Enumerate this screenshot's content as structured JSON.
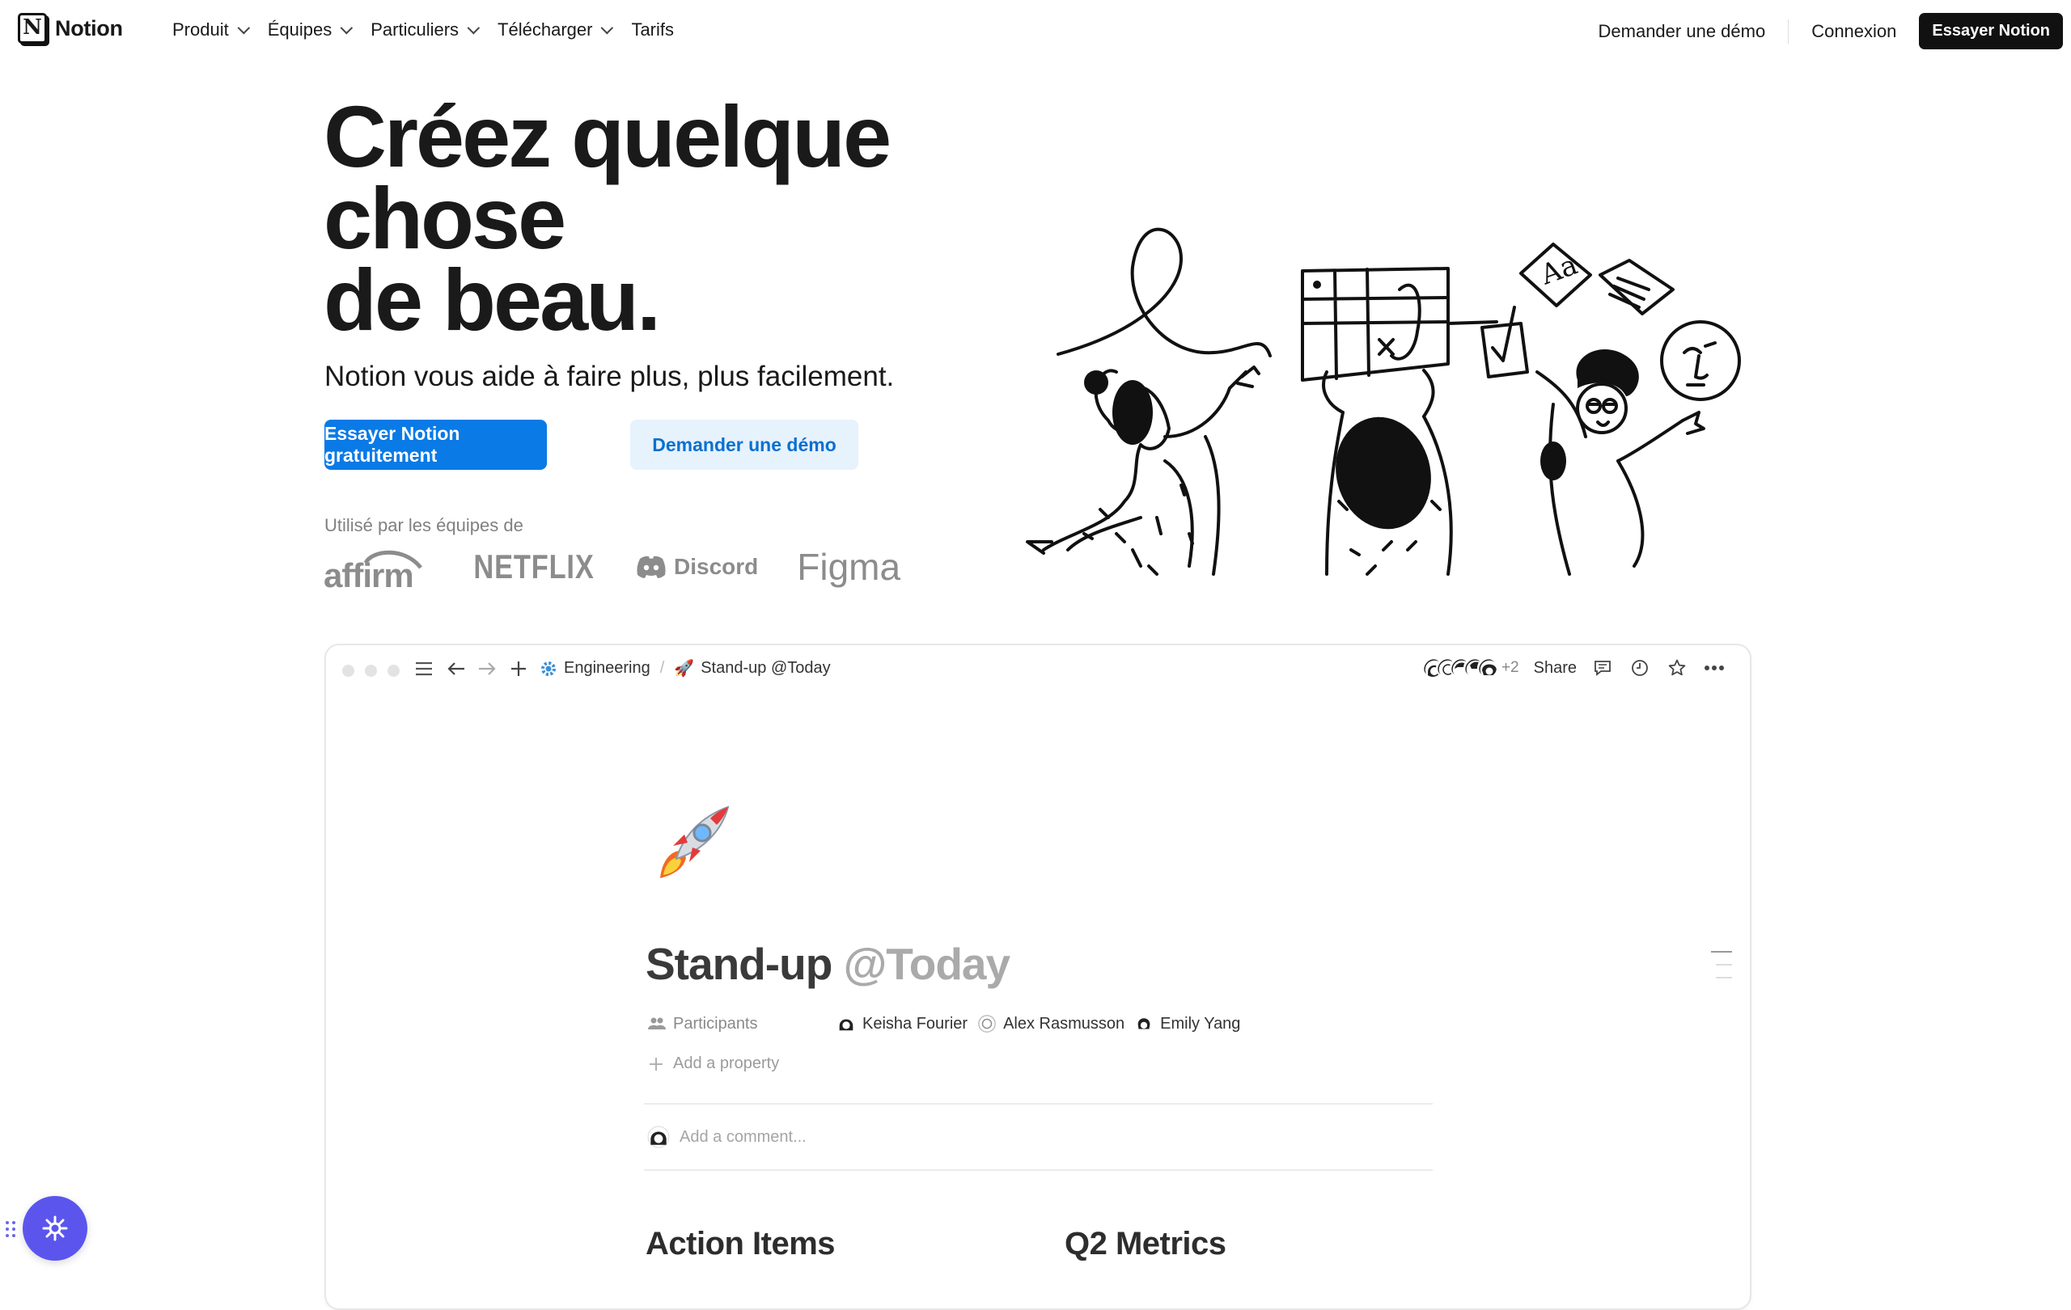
{
  "nav": {
    "brand": "Notion",
    "menu": [
      {
        "label": "Produit",
        "has_dropdown": true
      },
      {
        "label": "Équipes",
        "has_dropdown": true
      },
      {
        "label": "Particuliers",
        "has_dropdown": true
      },
      {
        "label": "Télécharger",
        "has_dropdown": true
      },
      {
        "label": "Tarifs",
        "has_dropdown": false
      }
    ],
    "demo_link": "Demander une démo",
    "login": "Connexion",
    "cta": "Essayer Notion"
  },
  "hero": {
    "title_line1": "Créez quelque",
    "title_line2": "chose",
    "title_line3": "de beau.",
    "subtitle": "Notion vous aide à faire plus, plus facilement.",
    "primary_button": "Essayer Notion gratuitement",
    "secondary_button": "Demander une démo",
    "used_by_label": "Utilisé par les équipes de",
    "customer_logos": [
      "affirm",
      "NETFLIX",
      "Discord",
      "Figma"
    ]
  },
  "app_window": {
    "breadcrumb": [
      {
        "icon": "gear-icon",
        "label": "Engineering"
      },
      {
        "icon": "rocket-icon",
        "label": "Stand-up @Today"
      }
    ],
    "breadcrumb_separator": "/",
    "extra_collaborators": "+2",
    "share_label": "Share",
    "page": {
      "emoji": "rocket-icon",
      "title": "Stand-up",
      "title_mention": "@Today",
      "property_label": "Participants",
      "participants": [
        "Keisha Fourier",
        "Alex Rasmusson",
        "Emily Yang"
      ],
      "add_property": "Add a property",
      "comment_placeholder": "Add a comment...",
      "section_left": "Action Items",
      "section_right": "Q2 Metrics"
    }
  },
  "colors": {
    "primary_blue": "#0a7ae6",
    "secondary_bg": "#e6f2fc",
    "widget_purple": "#5b55ee",
    "text_dark": "#1a1a1a",
    "logo_gray": "#8c8c8c"
  }
}
